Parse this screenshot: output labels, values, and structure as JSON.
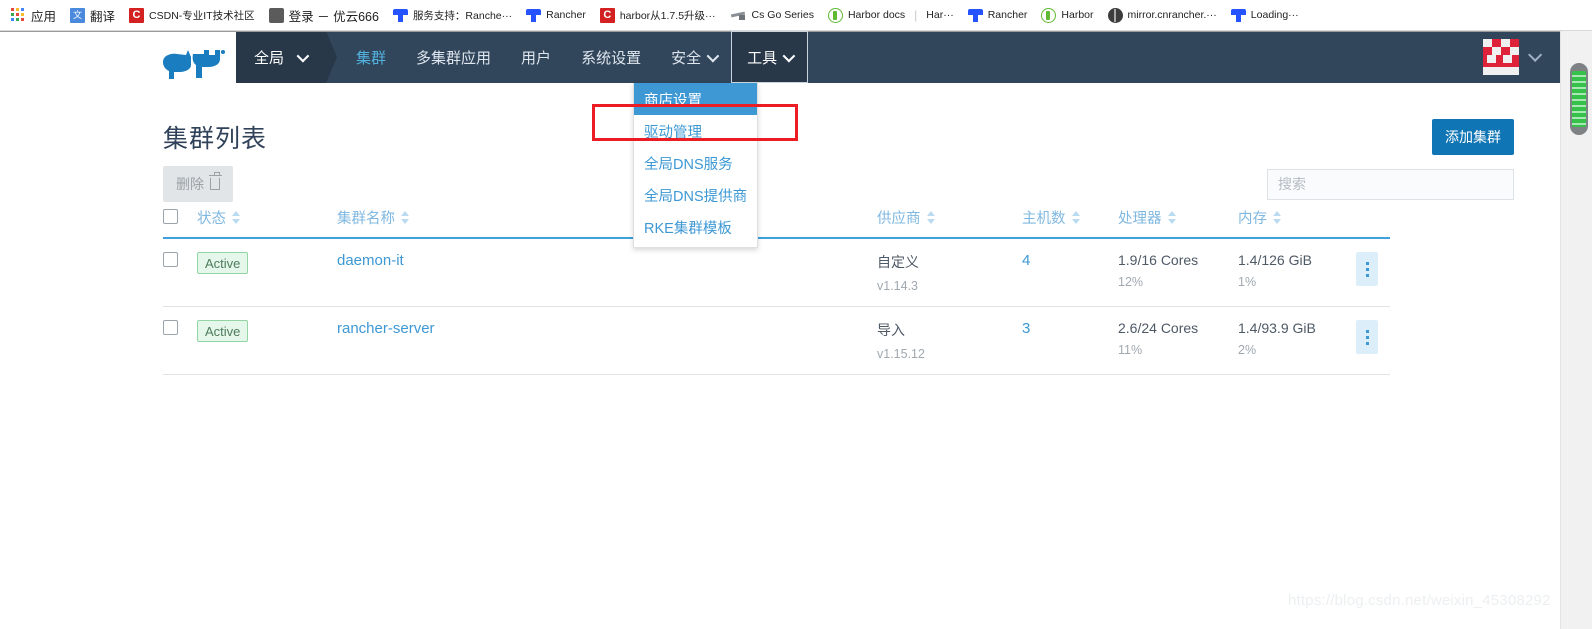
{
  "browser": {
    "bookmarks": [
      {
        "icon": "apps-grid-icon",
        "label": "应用",
        "small": false
      },
      {
        "icon": "translate-icon",
        "label": "翻译",
        "small": false
      },
      {
        "icon": "csdn-icon",
        "label": "CSDN-专业IT技术社区",
        "small": true
      },
      {
        "icon": "gray-avatar-icon",
        "label": "登录 － 优云666",
        "small": false
      },
      {
        "icon": "rancher-icon",
        "label": "服务支持：Ranche···",
        "small": true
      },
      {
        "icon": "rancher-icon",
        "label": "Rancher",
        "small": true
      },
      {
        "icon": "csdn-icon",
        "label": "harbor从1.7.5升级···",
        "small": true
      },
      {
        "icon": "csgo-icon",
        "label": "Cs Go Series",
        "small": true
      },
      {
        "icon": "harbor-icon",
        "label": "Harbor docs",
        "small": true
      },
      {
        "icon": "none",
        "label": "Har···",
        "small": true
      },
      {
        "icon": "rancher-icon",
        "label": "Rancher",
        "small": true
      },
      {
        "icon": "harbor-icon",
        "label": "Harbor",
        "small": true
      },
      {
        "icon": "globe-icon",
        "label": "mirror.cnrancher.···",
        "small": true
      },
      {
        "icon": "rancher-icon",
        "label": "Loading···",
        "small": true
      }
    ]
  },
  "nav": {
    "scope_label": "全局",
    "items": [
      {
        "label": "集群",
        "state": "active"
      },
      {
        "label": "多集群应用",
        "state": "normal"
      },
      {
        "label": "用户",
        "state": "normal"
      },
      {
        "label": "系统设置",
        "state": "normal"
      },
      {
        "label": "安全",
        "state": "caret"
      },
      {
        "label": "工具",
        "state": "open-caret"
      }
    ]
  },
  "dropdown": {
    "items": [
      {
        "label": "商店设置",
        "selected": true
      },
      {
        "label": "驱动管理",
        "selected": false
      },
      {
        "label": "全局DNS服务",
        "selected": false
      },
      {
        "label": "全局DNS提供商",
        "selected": false
      },
      {
        "label": "RKE集群模板",
        "selected": false
      }
    ]
  },
  "page": {
    "title": "集群列表",
    "add_button": "添加集群",
    "delete_button": "删除",
    "search_placeholder": "搜索",
    "search_value": ""
  },
  "table": {
    "columns": [
      "状态",
      "集群名称",
      "供应商",
      "主机数",
      "处理器",
      "内存"
    ],
    "rows": [
      {
        "status": "Active",
        "name": "daemon-it",
        "provider": "自定义",
        "provider_version": "v1.14.3",
        "hosts": "4",
        "cpu": "1.9/16 Cores",
        "cpu_pct": "12%",
        "mem": "1.4/126 GiB",
        "mem_pct": "1%"
      },
      {
        "status": "Active",
        "name": "rancher-server",
        "provider": "导入",
        "provider_version": "v1.15.12",
        "hosts": "3",
        "cpu": "2.6/24 Cores",
        "cpu_pct": "11%",
        "mem": "1.4/93.9 GiB",
        "mem_pct": "2%"
      }
    ]
  },
  "watermark": "https://blog.csdn.net/weixin_45308292",
  "colors": {
    "nav_bg": "#31455b",
    "nav_scope_bg": "#283849",
    "accent_blue": "#3d98d4",
    "primary_button": "#0f75b4",
    "annotation_red": "#ec1c24",
    "active_badge_green": "#4d7c5b"
  }
}
